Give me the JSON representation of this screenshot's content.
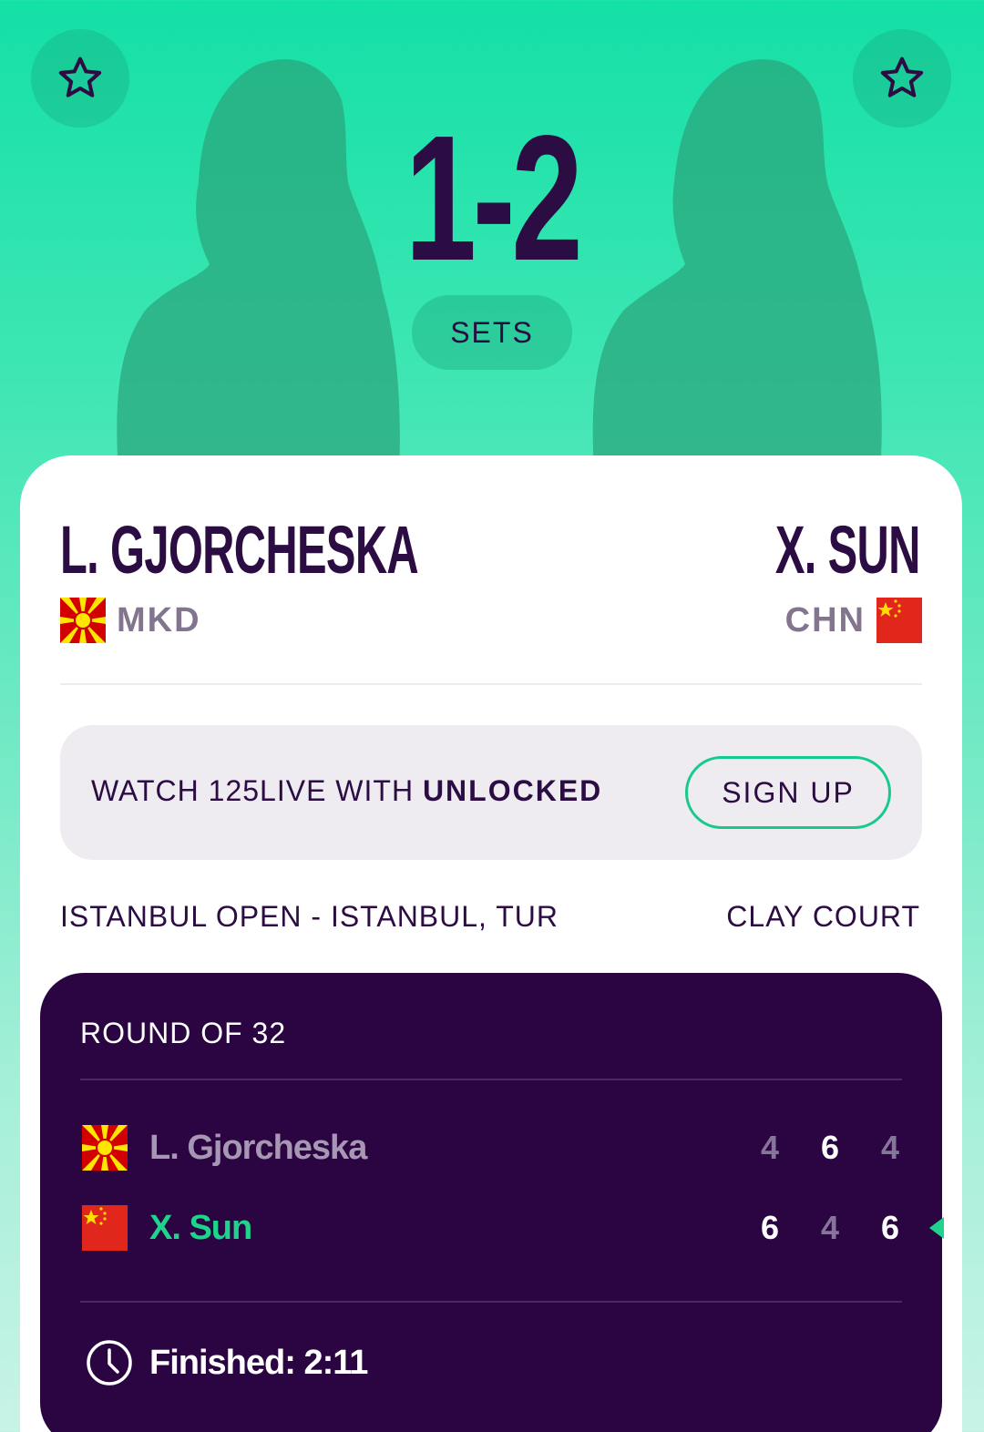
{
  "colors": {
    "accent_green": "#1ed38c",
    "dark_purple": "#2b0541",
    "text_purple": "#2b0c43",
    "muted": "#84758f"
  },
  "header": {
    "score": "1-2",
    "score_label": "SETS",
    "favorite_icon": "star-outline-icon"
  },
  "players": {
    "home": {
      "name": "L. GJORCHESKA",
      "country": "MKD",
      "flag_icon": "flag-north-macedonia-icon"
    },
    "away": {
      "name": "X. SUN",
      "country": "CHN",
      "flag_icon": "flag-china-icon"
    }
  },
  "promo": {
    "text_prefix": "WATCH 125LIVE WITH ",
    "text_bold": "UNLOCKED",
    "button_label": "SIGN UP"
  },
  "match_info": {
    "tournament": "ISTANBUL OPEN - ISTANBUL, TUR",
    "surface": "CLAY COURT"
  },
  "scoreboard": {
    "round": "ROUND OF 32",
    "rows": [
      {
        "name": "L. Gjorcheska",
        "sets": [
          "4",
          "6",
          "4"
        ],
        "set_won": [
          false,
          true,
          false
        ],
        "winner": false
      },
      {
        "name": "X. Sun",
        "sets": [
          "6",
          "4",
          "6"
        ],
        "set_won": [
          true,
          false,
          true
        ],
        "winner": true
      }
    ],
    "status": "Finished: 2:11",
    "status_icon": "clock-icon"
  }
}
